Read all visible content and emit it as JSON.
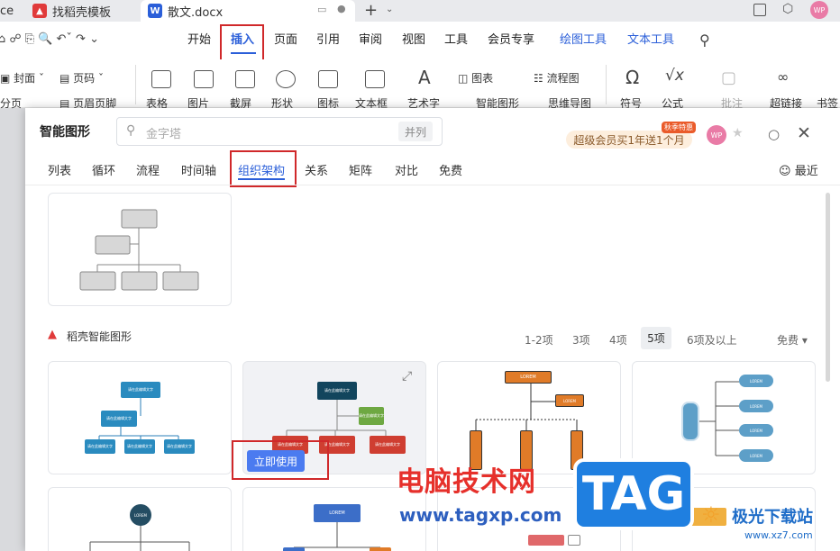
{
  "tabs": [
    {
      "label": "ce",
      "icon": ""
    },
    {
      "label": "找稻壳模板",
      "icon": "docer-icon"
    },
    {
      "label": "散文.docx",
      "icon": "word-icon"
    }
  ],
  "tabbar_right": {
    "avatar": "WP"
  },
  "menu": [
    "开始",
    "插入",
    "页面",
    "引用",
    "审阅",
    "视图",
    "工具",
    "会员专享",
    "绘图工具",
    "文本工具"
  ],
  "toolbar": {
    "row1": [
      "封面",
      "页码",
      "图表",
      "流程图",
      "超链接",
      "书签"
    ],
    "row2": [
      "分页",
      "页眉页脚",
      "表格",
      "图片",
      "截屏",
      "形状",
      "图标",
      "文本框",
      "艺术字",
      "智能图形",
      "思维导图",
      "符号",
      "公式",
      "批注"
    ]
  },
  "dialog": {
    "title": "智能图形",
    "search_placeholder": "金字塔",
    "search_tag": "并列",
    "promo": "超级会员买1年送1个月",
    "promo_badge": "秋季特惠",
    "avatar": "WP",
    "categories": [
      "列表",
      "循环",
      "流程",
      "时间轴",
      "组织架构",
      "关系",
      "矩阵",
      "对比",
      "免费"
    ],
    "recent": "最近",
    "section_title": "稻壳智能图形",
    "filters": [
      "1-2项",
      "3项",
      "4项",
      "5项",
      "6项及以上"
    ],
    "free_label": "免费",
    "use_now": "立即使用",
    "node_text": "请在此编辑文字",
    "lorem": "LOREM"
  },
  "watermark": {
    "site_name": "电脑技术网",
    "site_url": "www.tagxp.com",
    "tag": "TAG",
    "right_name": "极光下载站",
    "right_url": "www.xz7.com"
  }
}
